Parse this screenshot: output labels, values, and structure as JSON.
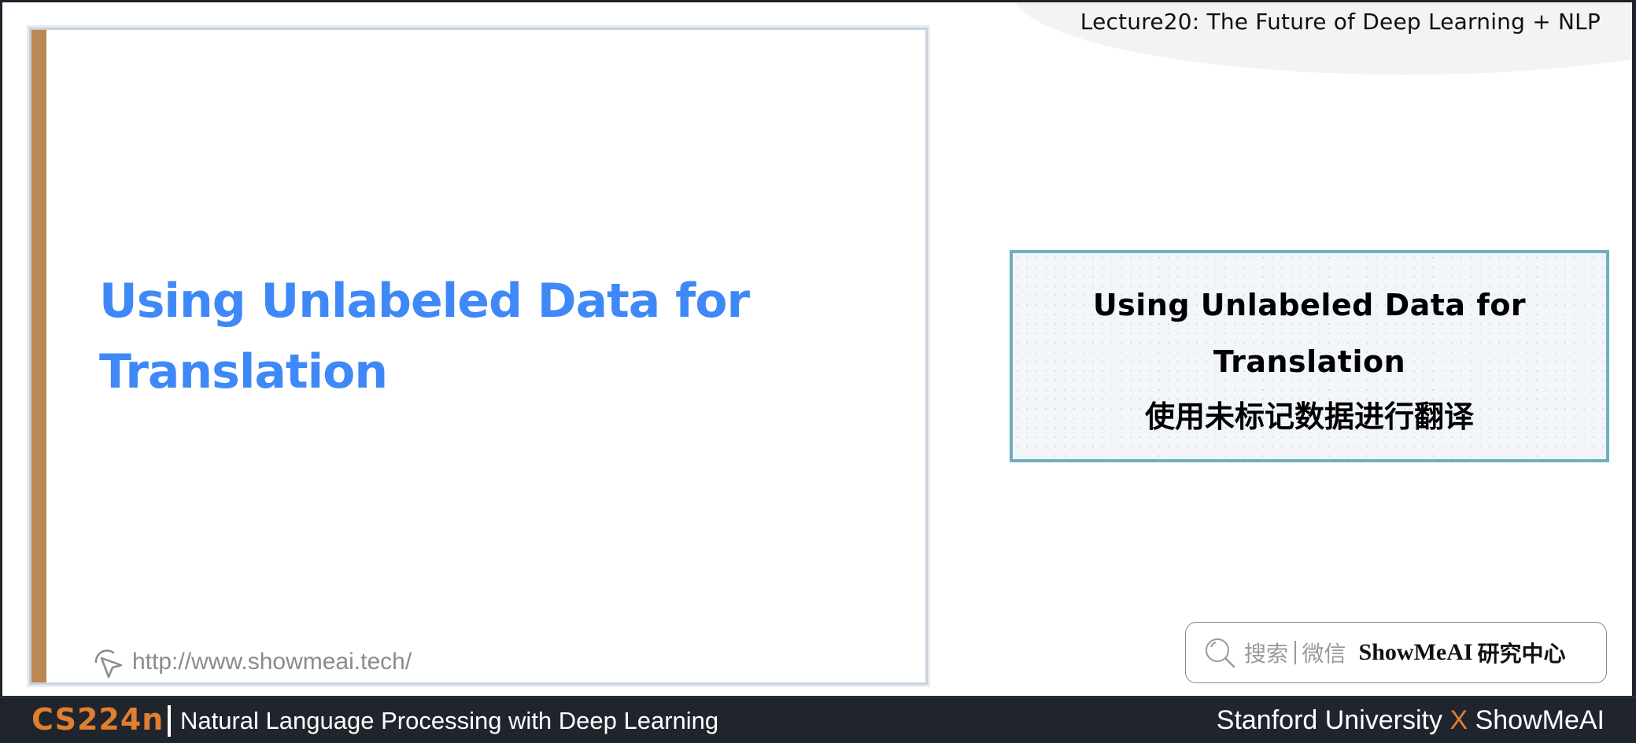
{
  "header": {
    "lecture_title": "Lecture20:  The Future of Deep Learning + NLP"
  },
  "slide": {
    "title": "Using Unlabeled Data for Translation",
    "title_lines": [
      "Using Unlabeled Data for",
      "Translation"
    ],
    "link_icon": "cursor-click-icon",
    "link_url": "http://www.showmeai.tech/",
    "accent_color": "#bb8753",
    "title_color": "#3f88f7"
  },
  "summary": {
    "en_lines": [
      "Using Unlabeled Data for",
      "Translation"
    ],
    "zh": "使用未标记数据进行翻译",
    "border_color": "#6eafbd"
  },
  "search": {
    "icon": "search-icon",
    "hint_left": "搜索",
    "hint_right": "微信",
    "brand": "ShowMeAI",
    "brand_zh": "研究中心"
  },
  "footer": {
    "course_code": "CS224n",
    "course_name": "Natural Language Processing with Deep Learning",
    "credit_left": "Stanford University",
    "credit_x": "X",
    "credit_right": "ShowMeAI",
    "accent_color": "#e07f30"
  }
}
